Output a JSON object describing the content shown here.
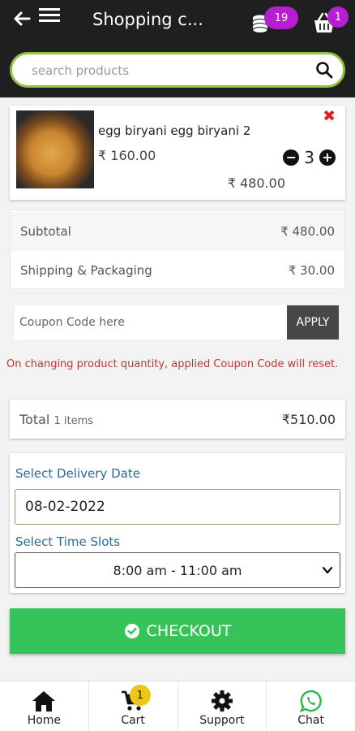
{
  "header": {
    "title": "Shopping c...",
    "coins_count": "19",
    "basket_count": "1",
    "search_placeholder": "search products"
  },
  "cart_item": {
    "name": "egg biryani egg biryani 2",
    "price": "₹ 160.00",
    "quantity": "3",
    "total": "₹ 480.00",
    "remove_symbol": "✖",
    "decrement_symbol": "−",
    "increment_symbol": "+"
  },
  "summary": {
    "subtotal_label": "Subtotal",
    "subtotal_value": "₹ 480.00",
    "shipping_label": "Shipping & Packaging",
    "shipping_value": "₹ 30.00"
  },
  "coupon": {
    "placeholder": "Coupon Code here",
    "apply_label": "APPLY",
    "warning": "On changing product quantity, applied Coupon Code will reset."
  },
  "total": {
    "label": "Total",
    "items": "1 items",
    "value": "₹510.00"
  },
  "delivery": {
    "date_label": "Select Delivery Date",
    "date_value": "08-02-2022",
    "slot_label": "Select Time Slots",
    "slot_value": "8:00 am - 11:00 am"
  },
  "checkout": {
    "label": "CHECKOUT"
  },
  "bottom_nav": {
    "home": "Home",
    "cart": "Cart",
    "cart_badge": "1",
    "support": "Support",
    "chat": "Chat"
  },
  "colors": {
    "header_bg": "#1f1f1f",
    "search_border": "#8fc23e",
    "badge_purple": "#b51fd1",
    "checkout_green": "#36c45a",
    "label_blue": "#2c6a9a",
    "warning_red": "#b53a3a",
    "cart_badge_yellow": "#f0c419"
  }
}
